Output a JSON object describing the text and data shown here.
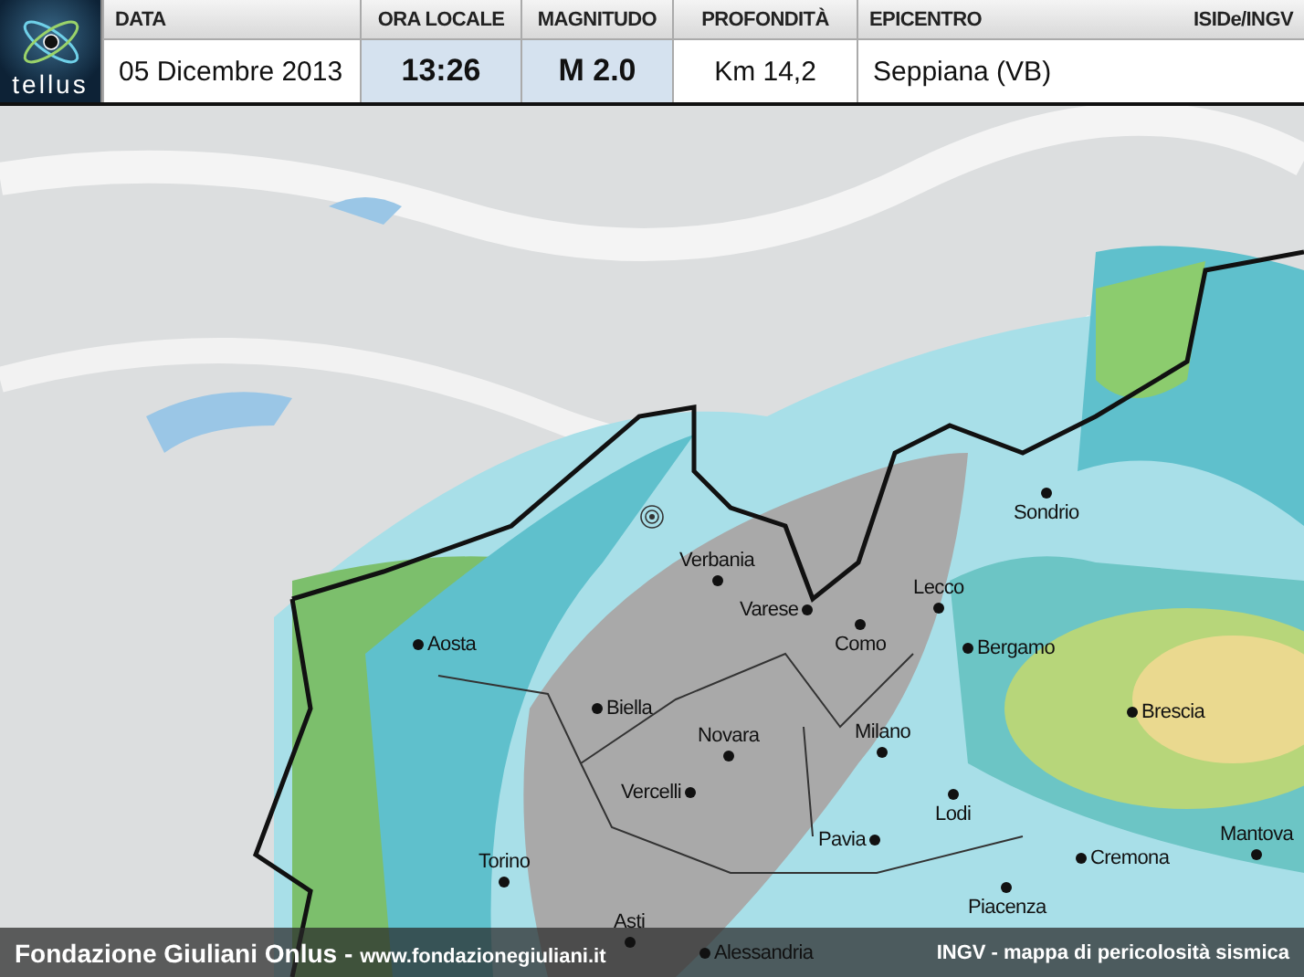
{
  "logo": {
    "text": "tellus"
  },
  "columns": [
    {
      "label": "DATA",
      "value": "05 Dicembre 2013",
      "highlighted": false
    },
    {
      "label": "ORA LOCALE",
      "value": "13:26",
      "highlighted": true
    },
    {
      "label": "MAGNITUDO",
      "value": "M 2.0",
      "highlighted": true
    },
    {
      "label": "PROFONDITÀ",
      "value": "Km 14,2",
      "highlighted": false
    },
    {
      "label": "EPICENTRO",
      "value": "Seppiana (VB)",
      "highlighted": false,
      "source": "ISIDe/INGV"
    }
  ],
  "cities": [
    "Sondrio",
    "Verbania",
    "Varese",
    "Lecco",
    "Aosta",
    "Como",
    "Bergamo",
    "Biella",
    "Brescia",
    "Novara",
    "Milano",
    "Vercelli",
    "Lodi",
    "Pavia",
    "Mantova",
    "Cremona",
    "Torino",
    "Piacenza",
    "Asti",
    "Alessandria"
  ],
  "footer": {
    "organization": "Fondazione Giuliani Onlus -",
    "website": "www.fondazionegiuliani.it",
    "caption": "INGV - mappa di pericolosità sismica"
  }
}
